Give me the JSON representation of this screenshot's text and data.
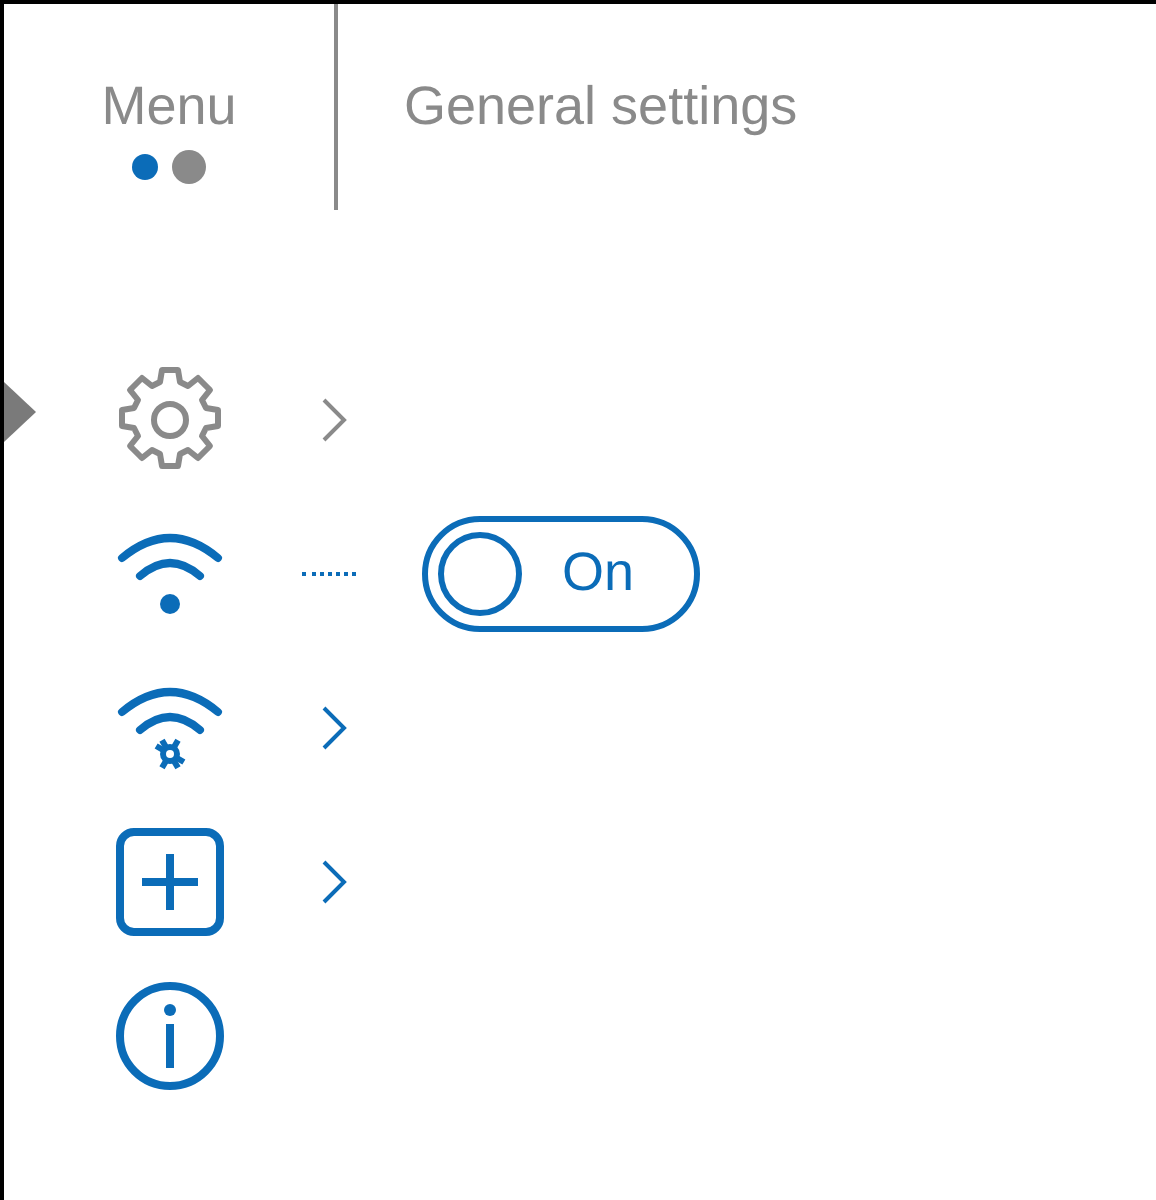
{
  "header": {
    "menu_label": "Menu",
    "pages": [
      {
        "selected": true
      },
      {
        "selected": false
      }
    ],
    "title": "General settings"
  },
  "items": [
    {
      "kind": "gear",
      "selected": true,
      "submenu": true
    },
    {
      "kind": "wifi",
      "selected": false,
      "submenu": false,
      "toggle": {
        "label": "On",
        "on": true
      }
    },
    {
      "kind": "wifi_settings",
      "selected": false,
      "submenu": true
    },
    {
      "kind": "add",
      "selected": false,
      "submenu": true
    },
    {
      "kind": "info",
      "selected": false,
      "submenu": false
    }
  ]
}
